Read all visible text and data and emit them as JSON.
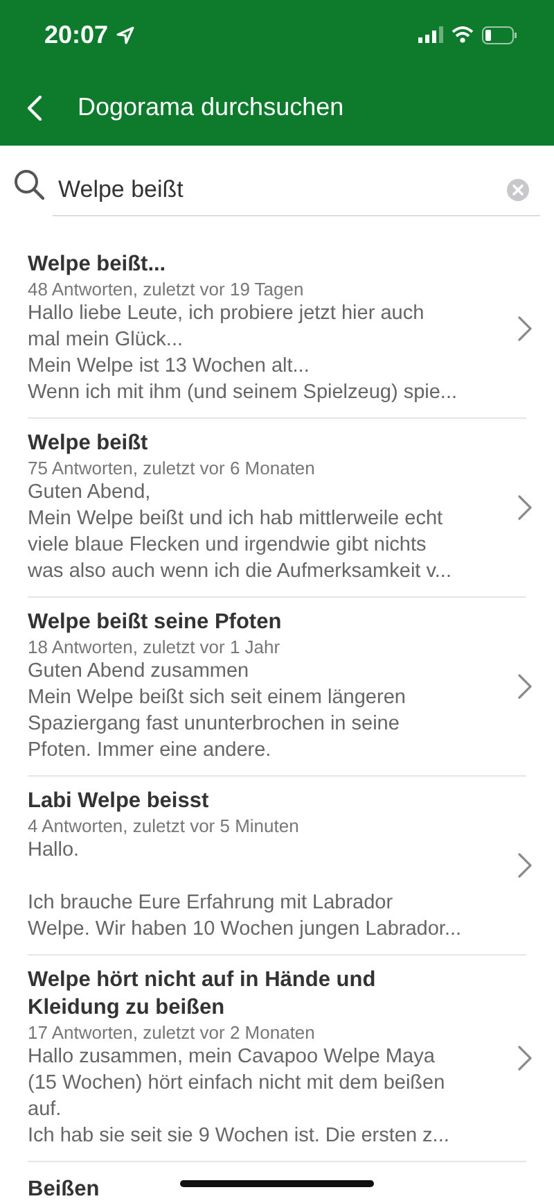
{
  "status_bar": {
    "time": "20:07"
  },
  "header": {
    "title": "Dogorama durchsuchen"
  },
  "search": {
    "value": "Welpe beißt"
  },
  "results": [
    {
      "title": "Welpe beißt...",
      "meta": "48 Antworten, zuletzt vor 19 Tagen",
      "paragraphs": [
        [
          "Hallo liebe Leute, ich probiere jetzt hier auch",
          "mal mein Glück...",
          "Mein Welpe ist 13 Wochen alt...",
          "Wenn ich mit ihm (und seinem Spielzeug) spie..."
        ]
      ]
    },
    {
      "title": "Welpe beißt",
      "meta": "75 Antworten, zuletzt vor 6 Monaten",
      "paragraphs": [
        [
          "Guten Abend,",
          "Mein Welpe beißt und ich hab mittlerweile echt",
          "viele blaue Flecken und irgendwie gibt nichts",
          "was also auch wenn ich die Aufmerksamkeit v..."
        ]
      ]
    },
    {
      "title": "Welpe beißt seine Pfoten",
      "meta": "18 Antworten, zuletzt vor 1 Jahr",
      "paragraphs": [
        [
          "Guten Abend zusammen",
          "Mein Welpe beißt sich seit einem längeren",
          "Spaziergang fast ununterbrochen in seine",
          "Pfoten. Immer eine andere."
        ]
      ]
    },
    {
      "title": "Labi Welpe beisst",
      "meta": "4 Antworten, zuletzt vor 5 Minuten",
      "paragraphs": [
        [
          "Hallo."
        ],
        [
          "Ich brauche Eure Erfahrung mit Labrador",
          "Welpe. Wir haben 10 Wochen jungen Labrador..."
        ]
      ]
    },
    {
      "title": "Welpe hört nicht auf in Hände und Kleidung zu beißen",
      "meta": "17 Antworten, zuletzt vor 2 Monaten",
      "paragraphs": [
        [
          "Hallo zusammen, mein Cavapoo Welpe Maya",
          "(15 Wochen) hört einfach nicht mit dem beißen",
          "auf.",
          "Ich hab sie seit sie 9 Wochen ist. Die ersten z..."
        ]
      ]
    },
    {
      "title": "Beißen"
    }
  ]
}
